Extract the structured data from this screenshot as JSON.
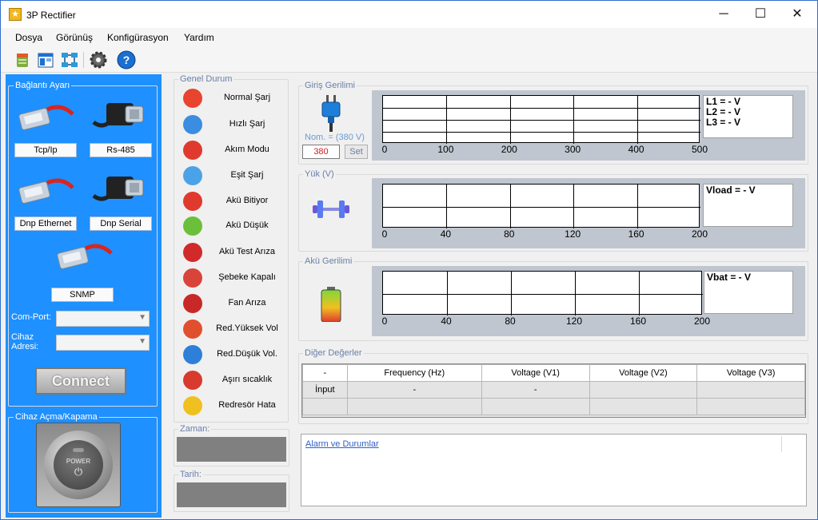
{
  "window": {
    "title": "3P Rectifier",
    "minimize": "─",
    "maximize": "☐",
    "close": "✕"
  },
  "menu": [
    "Dosya",
    "Görünüş",
    "Konfigürasyon",
    "Yardım"
  ],
  "toolbar": {
    "icons": [
      "database-icon",
      "layout-icon",
      "network-icon",
      "gear-icon",
      "help-icon"
    ],
    "help_glyph": "?"
  },
  "left_panel": {
    "connection_title": "Bağlantı Ayarı",
    "buttons": [
      "Tcp/Ip",
      "Rs-485",
      "Dnp Ethernet",
      "Dnp Serial",
      "SNMP"
    ],
    "com_port_label": "Com-Port:",
    "device_address_label_1": "Cihaz",
    "device_address_label_2": "Adresi:",
    "connect_label": "Connect",
    "power_title": "Cihaz Açma/Kapama",
    "power_label": "POWER",
    "accent_color": "#1e90ff"
  },
  "general_status": {
    "title": "Genel Durum",
    "items": [
      {
        "label": "Normal Şarj",
        "icon": "lifebuoy-icon",
        "color": "#e8442e"
      },
      {
        "label": "Hızlı Şarj",
        "icon": "runner-icon",
        "color": "#3a8de0"
      },
      {
        "label": "Akım Modu",
        "icon": "lock-icon",
        "color": "#e03a2e"
      },
      {
        "label": "Eşit Şarj",
        "icon": "sliders-icon",
        "color": "#4aa3e8"
      },
      {
        "label": "Akü Bitiyor",
        "icon": "battery-empty-icon",
        "color": "#e03a2e"
      },
      {
        "label": "Akü Düşük",
        "icon": "battery-low-icon",
        "color": "#6bbf3a"
      },
      {
        "label": "Akü Test Arıza",
        "icon": "no-entry-icon",
        "color": "#d02a2a"
      },
      {
        "label": "Şebeke Kapalı",
        "icon": "toggle-off-icon",
        "color": "#d8443a"
      },
      {
        "label": "Fan Arıza",
        "icon": "fan-icon",
        "color": "#c82828"
      },
      {
        "label": "Red.Yüksek Vol",
        "icon": "bolt-high-icon",
        "color": "#e0502e"
      },
      {
        "label": "Red.Düşük Vol.",
        "icon": "bolt-low-icon",
        "color": "#2e7fd8"
      },
      {
        "label": "Aşırı sıcaklık",
        "icon": "thermometer-icon",
        "color": "#d83a2e"
      },
      {
        "label": "Redresör Hata",
        "icon": "warning-icon",
        "color": "#f0c020"
      }
    ],
    "time_label": "Zaman:",
    "date_label": "Tarih:"
  },
  "charts": {
    "input": {
      "title": "Giriş Gerilimi",
      "nominal": "Nom. = (380 V)",
      "input_value": "380",
      "set_label": "Set",
      "legend": [
        "L1 = - V",
        "L2 = - V",
        "L3 = - V"
      ]
    },
    "load": {
      "title": "Yük (V)",
      "legend": [
        "Vload = - V"
      ]
    },
    "battery": {
      "title": "Akü Gerilimi",
      "legend": [
        "Vbat = - V"
      ]
    }
  },
  "chart_data": [
    {
      "type": "line",
      "title": "Giriş Gerilimi",
      "xlim": [
        0,
        500
      ],
      "xticks": [
        "0",
        "100",
        "200",
        "300",
        "400",
        "500"
      ],
      "hgrid": 4,
      "series": [],
      "legend": [
        "L1 = - V",
        "L2 = - V",
        "L3 = - V"
      ]
    },
    {
      "type": "line",
      "title": "Yük (V)",
      "xlim": [
        0,
        200
      ],
      "xticks": [
        "0",
        "40",
        "80",
        "120",
        "160",
        "200"
      ],
      "hgrid": 2,
      "series": [],
      "legend": [
        "Vload = - V"
      ]
    },
    {
      "type": "line",
      "title": "Akü Gerilimi",
      "xlim": [
        0,
        200
      ],
      "xticks": [
        "0",
        "40",
        "80",
        "120",
        "160",
        "200"
      ],
      "hgrid": 2,
      "series": [],
      "legend": [
        "Vbat = - V"
      ]
    }
  ],
  "other_values": {
    "title": "Diğer Değerler",
    "headers": [
      "-",
      "Frequency (Hz)",
      "Voltage (V1)",
      "Voltage (V2)",
      "Voltage (V3)"
    ],
    "rows": [
      [
        "İnput",
        "-",
        "-",
        "",
        ""
      ],
      [
        "",
        "",
        "",
        "",
        ""
      ]
    ]
  },
  "alarms": {
    "link": "Alarm ve Durumlar"
  }
}
